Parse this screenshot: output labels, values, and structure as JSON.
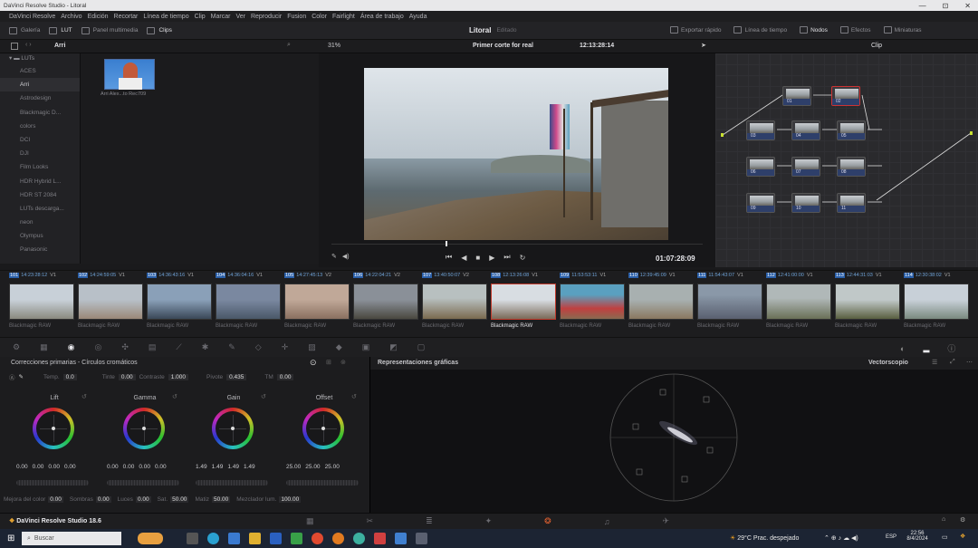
{
  "window": {
    "title": "DaVinci Resolve Studio - Litoral",
    "minimize": "—",
    "maximize": "⊡",
    "close": "✕"
  },
  "menu": [
    "DaVinci Resolve",
    "Archivo",
    "Edición",
    "Recortar",
    "Línea de tiempo",
    "Clip",
    "Marcar",
    "Ver",
    "Reproducir",
    "Fusion",
    "Color",
    "Fairlight",
    "Área de trabajo",
    "Ayuda"
  ],
  "toolbar": {
    "galeria": "Galería",
    "lut": "LUT",
    "panel_multimedia": "Panel multimedia",
    "clips": "Clips",
    "project": "Litoral",
    "project_status": "Editado",
    "exportar": "Exportar rápido",
    "linea_tiempo": "Línea de tiempo",
    "nodos": "Nodos",
    "efectos": "Efectos",
    "miniaturas": "Miniaturas"
  },
  "subbar": {
    "breadcrumb": "Arri",
    "zoom": "31%",
    "timeline_name": "Primer corte for real",
    "timecode": "12:13:28:14",
    "clip_label": "Clip"
  },
  "lut_panel": {
    "header": "LUTs",
    "items": [
      "ACES",
      "Arri",
      "Astrodesign",
      "Blackmagic D...",
      "colors",
      "DCI",
      "DJI",
      "Film Looks",
      "HDR Hybrid L...",
      "HDR ST 2084",
      "LUTs descarga...",
      "neon",
      "Olympus",
      "Panasonic"
    ],
    "selected_index": 1,
    "thumb_label": "Arri Alex...to Rec709"
  },
  "viewer": {
    "timecode": "01:07:28:09"
  },
  "nodes": [
    {
      "label": "01"
    },
    {
      "label": "02"
    },
    {
      "label": "03"
    },
    {
      "label": "04"
    },
    {
      "label": "05"
    },
    {
      "label": "06"
    },
    {
      "label": "07"
    },
    {
      "label": "08"
    },
    {
      "label": "09"
    },
    {
      "label": "10"
    },
    {
      "label": "11"
    }
  ],
  "clips": [
    {
      "num": "101",
      "tc": "14:23:28:12",
      "track": "V1",
      "format": "Blackmagic RAW"
    },
    {
      "num": "102",
      "tc": "14:24:59:05",
      "track": "V1",
      "format": "Blackmagic RAW"
    },
    {
      "num": "103",
      "tc": "14:36:43:16",
      "track": "V1",
      "format": "Blackmagic RAW"
    },
    {
      "num": "104",
      "tc": "14:36:04:16",
      "track": "V1",
      "format": "Blackmagic RAW"
    },
    {
      "num": "105",
      "tc": "14:27:45:13",
      "track": "V2",
      "format": "Blackmagic RAW"
    },
    {
      "num": "106",
      "tc": "14:22:04:21",
      "track": "V2",
      "format": "Blackmagic RAW"
    },
    {
      "num": "107",
      "tc": "13:40:50:07",
      "track": "V2",
      "format": "Blackmagic RAW"
    },
    {
      "num": "108",
      "tc": "12:13:26:08",
      "track": "V1",
      "format": "Blackmagic RAW"
    },
    {
      "num": "109",
      "tc": "11:53:53:11",
      "track": "V1",
      "format": "Blackmagic RAW"
    },
    {
      "num": "110",
      "tc": "12:39:45:09",
      "track": "V1",
      "format": "Blackmagic RAW"
    },
    {
      "num": "111",
      "tc": "11:54:43:07",
      "track": "V1",
      "format": "Blackmagic RAW"
    },
    {
      "num": "112",
      "tc": "12:41:00:00",
      "track": "V1",
      "format": "Blackmagic RAW"
    },
    {
      "num": "113",
      "tc": "12:44:31:03",
      "track": "V1",
      "format": "Blackmagic RAW"
    },
    {
      "num": "114",
      "tc": "12:30:38:02",
      "track": "V1",
      "format": "Blackmagic RAW"
    }
  ],
  "primaries": {
    "title": "Correcciones primarias - Círculos cromáticos",
    "temp_label": "Temp.",
    "temp": "0.0",
    "tinte_label": "Tinte",
    "tinte": "0.00",
    "contraste_label": "Contraste",
    "contraste": "1.000",
    "pivote_label": "Pivote",
    "pivote": "0.435",
    "tm_label": "TM",
    "tm": "0.00",
    "wheels": [
      {
        "name": "Lift",
        "values": [
          "0.00",
          "0.00",
          "0.00",
          "0.00"
        ]
      },
      {
        "name": "Gamma",
        "values": [
          "0.00",
          "0.00",
          "0.00",
          "0.00"
        ]
      },
      {
        "name": "Gain",
        "values": [
          "1.49",
          "1.49",
          "1.49",
          "1.49"
        ]
      },
      {
        "name": "Offset",
        "values": [
          "25.00",
          "25.00",
          "25.00"
        ]
      }
    ],
    "bottom": [
      {
        "label": "Mejora del color",
        "value": "0.00"
      },
      {
        "label": "Sombras",
        "value": "0.00"
      },
      {
        "label": "Luces",
        "value": "0.00"
      },
      {
        "label": "Sat.",
        "value": "50.00"
      },
      {
        "label": "Matiz",
        "value": "50.00"
      },
      {
        "label": "Mezclador lum.",
        "value": "100.00"
      }
    ]
  },
  "scopes": {
    "title": "Representaciones gráficas",
    "mode": "Vectorscopio"
  },
  "app_footer": {
    "name": "DaVinci Resolve Studio 18.6"
  },
  "taskbar": {
    "search": "Buscar",
    "weather": "29°C Prac. despejado",
    "lang": "ESP",
    "time": "22:56",
    "date": "8/4/2024"
  },
  "colors": {
    "accent": "#c0392b",
    "clip_blue": "#2a5fa8",
    "node_label": "#2e3f6a"
  }
}
